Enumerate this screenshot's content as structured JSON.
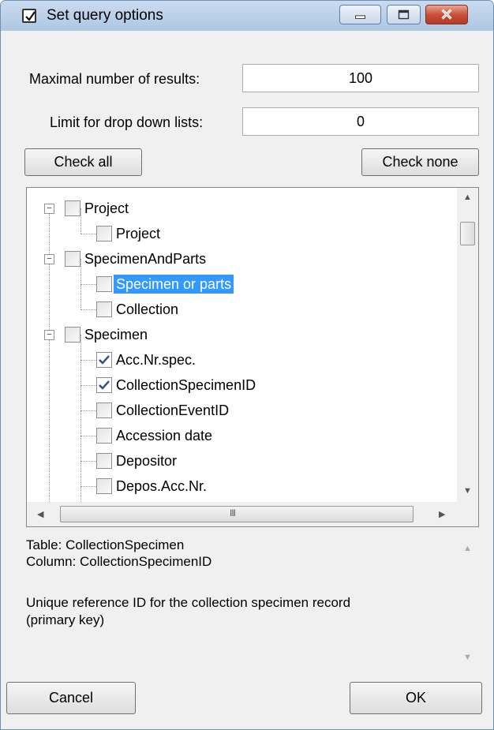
{
  "window": {
    "title": "Set query options",
    "controls": [
      "minimize-icon",
      "maximize-icon",
      "close-icon"
    ]
  },
  "fields": {
    "max_results_label": "Maximal number of results:",
    "max_results_value": "100",
    "dropdown_limit_label": "Limit for drop down lists:",
    "dropdown_limit_value": "0"
  },
  "buttons": {
    "check_all": "Check all",
    "check_none": "Check none",
    "cancel": "Cancel",
    "ok": "OK"
  },
  "tree": {
    "groups": [
      {
        "label": "Project",
        "checked": false,
        "expanded": true,
        "children": [
          {
            "label": "Project",
            "checked": false
          }
        ]
      },
      {
        "label": "SpecimenAndParts",
        "checked": false,
        "expanded": true,
        "children": [
          {
            "label": "Specimen or parts",
            "checked": false,
            "selected": true
          },
          {
            "label": "Collection",
            "checked": false
          }
        ]
      },
      {
        "label": "Specimen",
        "checked": false,
        "expanded": true,
        "children": [
          {
            "label": "Acc.Nr.spec.",
            "checked": true
          },
          {
            "label": "CollectionSpecimenID",
            "checked": true
          },
          {
            "label": "CollectionEventID",
            "checked": false
          },
          {
            "label": "Accession date",
            "checked": false
          },
          {
            "label": "Depositor",
            "checked": false
          },
          {
            "label": "Depos.Acc.Nr.",
            "checked": false
          }
        ]
      }
    ],
    "selection_color": "#3399ff"
  },
  "description": {
    "lines": [
      "Table: CollectionSpecimen",
      "Column: CollectionSpecimenID",
      "",
      "Unique reference ID for the collection specimen record",
      "(primary key)"
    ]
  }
}
